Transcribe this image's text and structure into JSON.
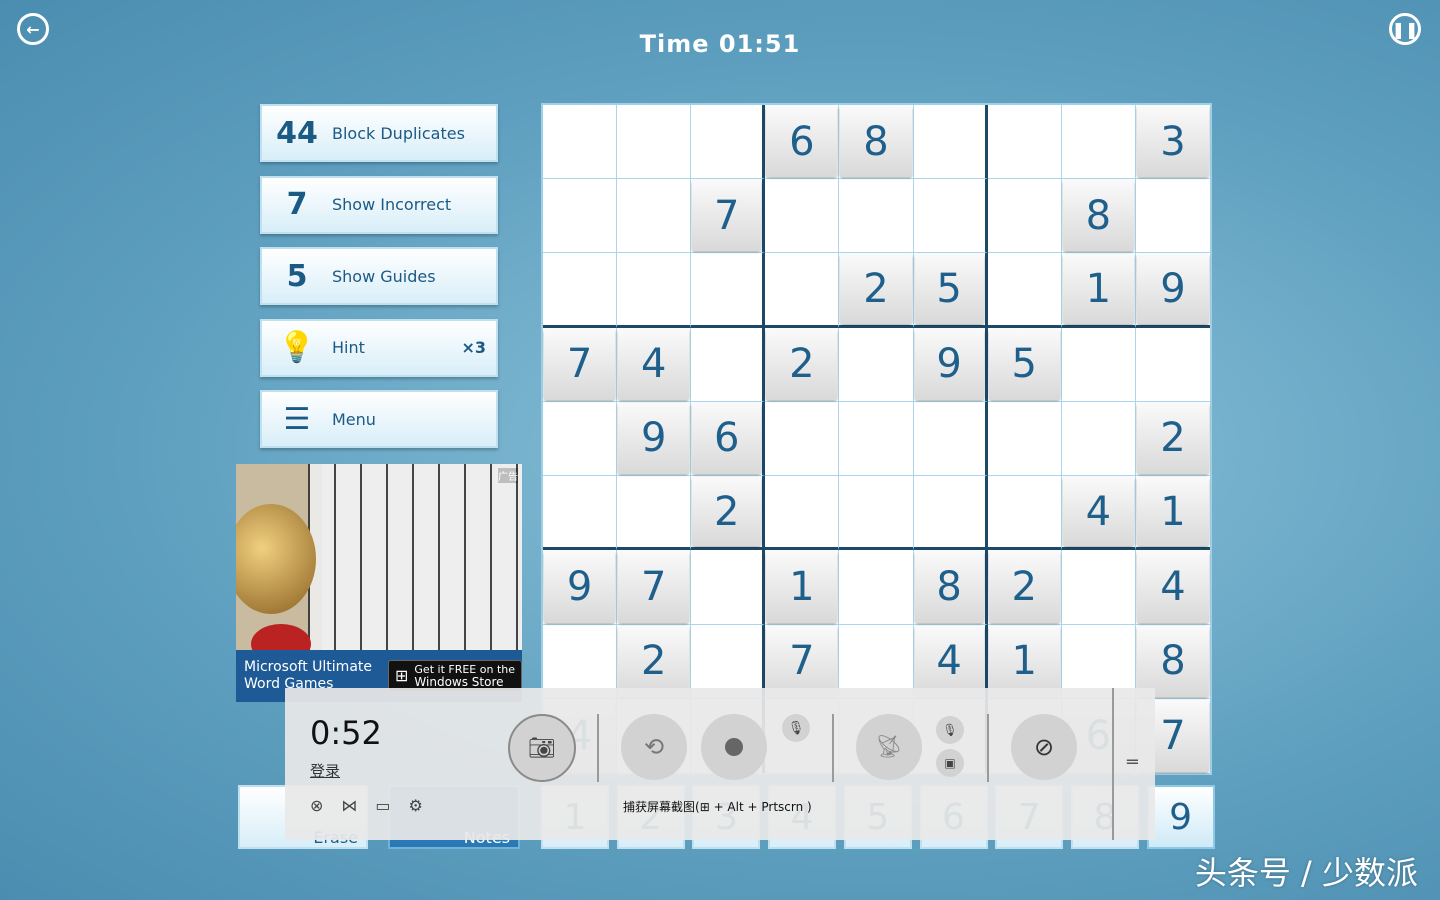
{
  "header": {
    "title": "Time 01:51",
    "back_icon": "back-arrow-icon",
    "pause_icon": "pause-icon"
  },
  "sidebar": {
    "items": [
      {
        "label": "Block Duplicates",
        "icon": "block-duplicates-icon",
        "glyph": "44"
      },
      {
        "label": "Show Incorrect",
        "icon": "show-incorrect-icon",
        "glyph": "7"
      },
      {
        "label": "Show Guides",
        "icon": "show-guides-icon",
        "glyph": "5"
      },
      {
        "label": "Hint",
        "icon": "lightbulb-icon",
        "glyph": "💡",
        "count": "×3"
      },
      {
        "label": "Menu",
        "icon": "menu-list-icon",
        "glyph": "☰"
      }
    ]
  },
  "ad": {
    "tag": "广告",
    "name": "Microsoft Ultimate Word Games",
    "store_line1": "Get it FREE on the",
    "store_line2": "Windows Store"
  },
  "board": {
    "rows": [
      [
        "",
        "",
        "",
        "6",
        "8",
        "",
        "",
        "",
        "3"
      ],
      [
        "",
        "",
        "7",
        "",
        "",
        "",
        "",
        "8",
        ""
      ],
      [
        "",
        "",
        "",
        "",
        "2",
        "5",
        "",
        "1",
        "9"
      ],
      [
        "7",
        "4",
        "",
        "2",
        "",
        "9",
        "5",
        "",
        ""
      ],
      [
        "",
        "9",
        "6",
        "",
        "",
        "",
        "",
        "",
        "2"
      ],
      [
        "",
        "",
        "2",
        "",
        "",
        "",
        "",
        "4",
        "1"
      ],
      [
        "9",
        "7",
        "",
        "1",
        "",
        "8",
        "2",
        "",
        "4"
      ],
      [
        "",
        "2",
        "",
        "7",
        "",
        "4",
        "1",
        "",
        "8"
      ],
      [
        "4",
        "",
        "",
        "",
        "",
        "",
        "",
        "6",
        "7"
      ]
    ]
  },
  "pad": {
    "numbers": [
      "1",
      "2",
      "3",
      "4",
      "5",
      "6",
      "7",
      "8",
      "9"
    ],
    "selected": "9",
    "erase_label": "Erase",
    "notes_label": "Notes"
  },
  "game_bar": {
    "timer": "0:52",
    "login": "登录",
    "hint": "捕获屏幕截图(",
    "hint_keys": " + Alt + Prtscrn )"
  },
  "watermark": "头条号 / 少数派"
}
